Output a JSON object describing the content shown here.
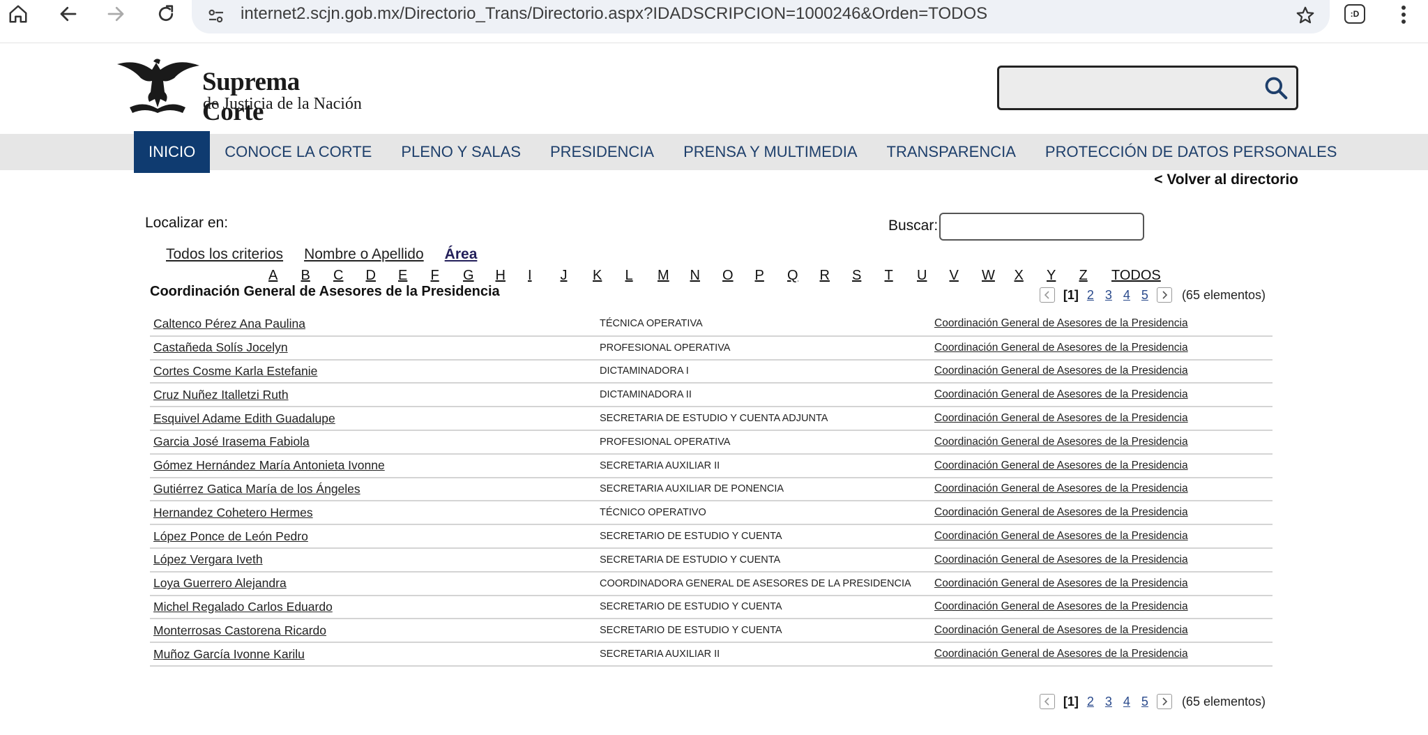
{
  "browser": {
    "url": "internet2.scjn.gob.mx/Directorio_Trans/Directorio.aspx?IDADSCRIPCION=1000246&Orden=TODOS",
    "extension_label": ":D"
  },
  "site": {
    "logo_line1": "Suprema Corte",
    "logo_line2": "de Justicia de la Nación"
  },
  "nav": {
    "items": [
      "INICIO",
      "CONOCE LA CORTE",
      "PLENO Y SALAS",
      "PRESIDENCIA",
      "PRENSA Y MULTIMEDIA",
      "TRANSPARENCIA",
      "PROTECCIÓN DE DATOS PERSONALES"
    ],
    "active": "INICIO"
  },
  "back_link": "< Volver al directorio",
  "search": {
    "localizar_label": "Localizar en:",
    "buscar_label": "Buscar:",
    "buscar_value": ""
  },
  "criteria": {
    "items": [
      "Todos los criterios",
      "Nombre o Apellido",
      "Área"
    ],
    "selected": "Área"
  },
  "alphabet": [
    "A",
    "B",
    "C",
    "D",
    "E",
    "F",
    "G",
    "H",
    "I",
    "J",
    "K",
    "L",
    "M",
    "N",
    "O",
    "P",
    "Q",
    "R",
    "S",
    "T",
    "U",
    "V",
    "W",
    "X",
    "Y",
    "Z",
    "TODOS"
  ],
  "area_title": "Coordinación General de Asesores de la Presidencia",
  "pager": {
    "current": "[1]",
    "pages": [
      "2",
      "3",
      "4",
      "5"
    ],
    "count": "(65 elementos)"
  },
  "rows": [
    {
      "name": "Caltenco Pérez Ana Paulina",
      "position": "TÉCNICA OPERATIVA",
      "area": "Coordinación General de Asesores de la Presidencia"
    },
    {
      "name": "Castañeda Solís Jocelyn",
      "position": "PROFESIONAL OPERATIVA",
      "area": "Coordinación General de Asesores de la Presidencia"
    },
    {
      "name": "Cortes Cosme Karla Estefanie",
      "position": "DICTAMINADORA I",
      "area": "Coordinación General de Asesores de la Presidencia"
    },
    {
      "name": "Cruz Nuñez Italletzi Ruth",
      "position": "DICTAMINADORA II",
      "area": "Coordinación General de Asesores de la Presidencia"
    },
    {
      "name": "Esquivel Adame Edith Guadalupe",
      "position": "SECRETARIA DE ESTUDIO Y CUENTA ADJUNTA",
      "area": "Coordinación General de Asesores de la Presidencia"
    },
    {
      "name": "Garcia José Irasema Fabiola",
      "position": "PROFESIONAL OPERATIVA",
      "area": "Coordinación General de Asesores de la Presidencia"
    },
    {
      "name": "Gómez Hernández María Antonieta Ivonne",
      "position": "SECRETARIA AUXILIAR II",
      "area": "Coordinación General de Asesores de la Presidencia"
    },
    {
      "name": "Gutiérrez Gatica María de los Ángeles",
      "position": "SECRETARIA AUXILIAR DE PONENCIA",
      "area": "Coordinación General de Asesores de la Presidencia"
    },
    {
      "name": "Hernandez Cohetero Hermes",
      "position": "TÉCNICO OPERATIVO",
      "area": "Coordinación General de Asesores de la Presidencia"
    },
    {
      "name": "López Ponce de León Pedro",
      "position": "SECRETARIO DE ESTUDIO Y CUENTA",
      "area": "Coordinación General de Asesores de la Presidencia"
    },
    {
      "name": "López Vergara Iveth",
      "position": "SECRETARIA DE ESTUDIO Y CUENTA",
      "area": "Coordinación General de Asesores de la Presidencia"
    },
    {
      "name": "Loya Guerrero Alejandra",
      "position": "COORDINADORA GENERAL DE ASESORES DE LA PRESIDENCIA",
      "area": "Coordinación General de Asesores de la Presidencia"
    },
    {
      "name": "Michel Regalado Carlos Eduardo",
      "position": "SECRETARIO DE ESTUDIO Y CUENTA",
      "area": "Coordinación General de Asesores de la Presidencia"
    },
    {
      "name": "Monterrosas Castorena Ricardo",
      "position": "SECRETARIO DE ESTUDIO Y CUENTA",
      "area": "Coordinación General de Asesores de la Presidencia"
    },
    {
      "name": "Muñoz García Ivonne Karilu",
      "position": "SECRETARIA AUXILIAR II",
      "area": "Coordinación General de Asesores de la Presidencia"
    }
  ]
}
